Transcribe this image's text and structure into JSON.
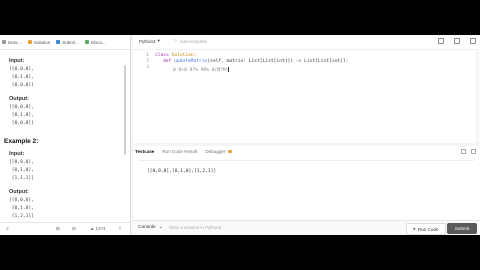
{
  "left_tabs": [
    {
      "label": "Desc..."
    },
    {
      "label": "Solution"
    },
    {
      "label": "Submi..."
    },
    {
      "label": "Discu..."
    }
  ],
  "example1": {
    "input_label": "Input:",
    "input_lines": [
      "[[0,0,0],",
      " [0,1,0],",
      " [0,0,0]]"
    ],
    "output_label": "Output:",
    "output_lines": [
      "[[0,0,0],",
      " [0,1,0],",
      " [0,0,0]]"
    ]
  },
  "example2": {
    "heading": "Example 2:",
    "input_label": "Input:",
    "input_lines": [
      "[[0,0,0],",
      " [0,1,0],",
      " [1,1,1]]"
    ],
    "output_label": "Output:",
    "output_lines": [
      "[[0,0,0],",
      " [0,1,0],",
      " [1,2,1]]"
    ]
  },
  "left_bottom": {
    "count": "1374"
  },
  "editor": {
    "language": "Python3",
    "autocomplete": "Autocomplete",
    "line_numbers": [
      "1",
      "2",
      "3"
    ],
    "line1_kw": "class",
    "line1_name": " Solution:",
    "line2_kw": "def",
    "line2_fn": " updateMatrix",
    "line2_rest": "(self, matrix: List[List[int]]) -> List[List[int]]:",
    "line3": "0 0+0 97% 98% 0(N*M)"
  },
  "result": {
    "tabs": [
      "Testcase",
      "Run Code Result",
      "Debugger"
    ],
    "value": "[[0,0,0],[0,1,0],[1,2,1]]"
  },
  "console": {
    "label": "Console",
    "hint": "Write a solution in Python3"
  },
  "buttons": {
    "run": "Run Code",
    "submit": "Submit"
  }
}
